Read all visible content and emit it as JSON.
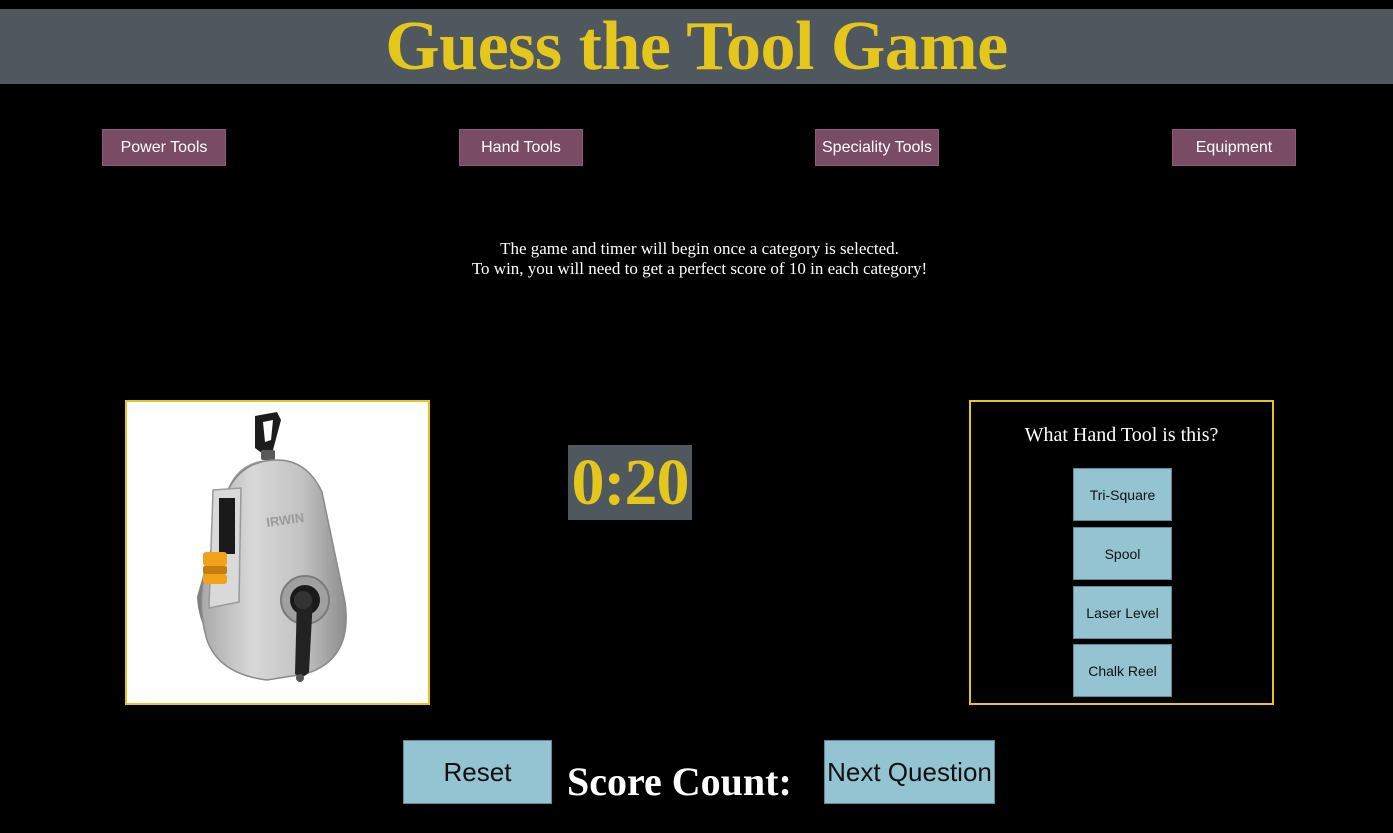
{
  "header": {
    "title": "Guess the Tool Game"
  },
  "categories": [
    {
      "label": "Power Tools"
    },
    {
      "label": "Hand Tools"
    },
    {
      "label": "Speciality Tools"
    },
    {
      "label": "Equipment"
    }
  ],
  "instructions": {
    "line1": "The game and timer will begin once a category is selected.",
    "line2": "To win, you will need to get a perfect score of 10 in each category!"
  },
  "tool_image": {
    "brand_mark": "IRWIN",
    "icon": "chalk-reel-image"
  },
  "timer": {
    "value": "0:20"
  },
  "question": {
    "prompt": "What Hand Tool is this?",
    "answers": [
      {
        "label": "Tri-Square"
      },
      {
        "label": "Spool"
      },
      {
        "label": "Laser Level"
      },
      {
        "label": "Chalk Reel"
      }
    ]
  },
  "footer": {
    "reset_label": "Reset",
    "score_label": "Score Count:",
    "next_label": "Next Question"
  },
  "colors": {
    "background": "#000000",
    "header_bg": "#4e585e",
    "accent_yellow": "#e5c61b",
    "category_button": "#7a4b65",
    "answer_button": "#94c4d1"
  }
}
